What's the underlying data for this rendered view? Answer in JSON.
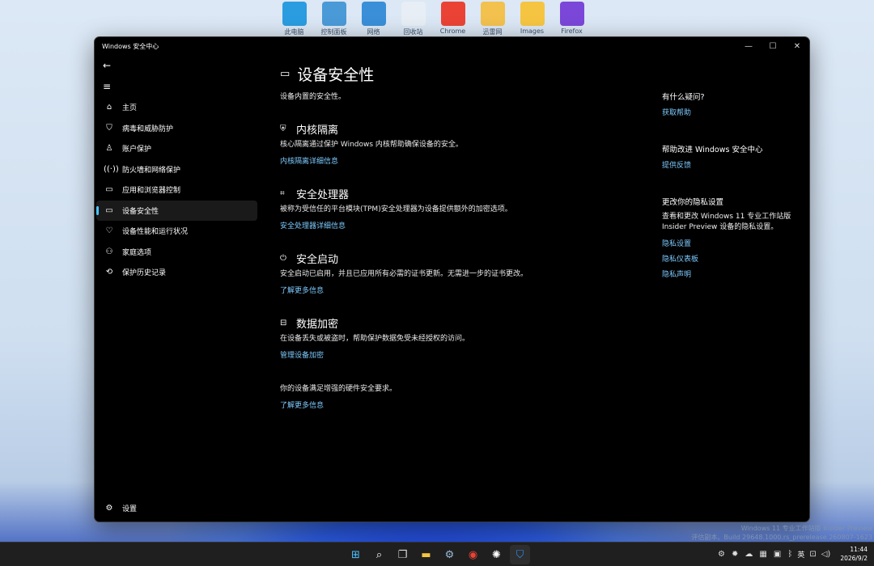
{
  "desktop": {
    "icons": [
      {
        "label": "此电脑",
        "icon": "computer-icon",
        "color": "#2a9de0"
      },
      {
        "label": "控制面板",
        "icon": "control-panel-icon",
        "color": "#4a9ad8"
      },
      {
        "label": "网络",
        "icon": "network-icon",
        "color": "#3a8fd8"
      },
      {
        "label": "回收站",
        "icon": "recycle-bin-icon",
        "color": "#e8eef5"
      },
      {
        "label": "Chrome",
        "icon": "chrome-icon",
        "color": "#ea4335"
      },
      {
        "label": "迅雷网",
        "icon": "contacts-icon",
        "color": "#f2c14e"
      },
      {
        "label": "Images",
        "icon": "folder-icon",
        "color": "#f5c542"
      },
      {
        "label": "Firefox",
        "icon": "firefox-icon",
        "color": "#7b47d8"
      }
    ]
  },
  "window": {
    "title": "Windows 安全中心",
    "controls": {
      "minimize": "—",
      "maximize": "☐",
      "close": "✕"
    }
  },
  "sidebar": {
    "back_icon": "←",
    "menu_icon": "≡",
    "items": [
      {
        "label": "主页",
        "icon": "⌂"
      },
      {
        "label": "病毒和威胁防护",
        "icon": "⛉"
      },
      {
        "label": "账户保护",
        "icon": "♙"
      },
      {
        "label": "防火墙和网络保护",
        "icon": "((·))"
      },
      {
        "label": "应用和浏览器控制",
        "icon": "▭"
      },
      {
        "label": "设备安全性",
        "icon": "▭"
      },
      {
        "label": "设备性能和运行状况",
        "icon": "♡"
      },
      {
        "label": "家庭选项",
        "icon": "⚇"
      },
      {
        "label": "保护历史记录",
        "icon": "⟲"
      }
    ],
    "settings": {
      "label": "设置",
      "icon": "⚙"
    }
  },
  "main": {
    "title": "设备安全性",
    "subtitle": "设备内置的安全性。",
    "sections": [
      {
        "title": "内核隔离",
        "icon": "⛨",
        "desc": "核心隔离通过保护 Windows 内核帮助确保设备的安全。",
        "link": "内核隔离详细信息"
      },
      {
        "title": "安全处理器",
        "icon": "⌗",
        "desc": "被称为受信任的平台模块(TPM)安全处理器为设备提供额外的加密选项。",
        "link": "安全处理器详细信息"
      },
      {
        "title": "安全启动",
        "icon": "⏻",
        "desc": "安全启动已启用，并且已应用所有必需的证书更新。无需进一步的证书更改。",
        "link": "了解更多信息"
      },
      {
        "title": "数据加密",
        "icon": "⊟",
        "desc": "在设备丢失或被盗时，帮助保护数据免受未经授权的访问。",
        "link": "管理设备加密"
      }
    ],
    "footer_text": "你的设备满足增强的硬件安全要求。",
    "footer_link": "了解更多信息"
  },
  "aside": {
    "help_heading": "有什么疑问?",
    "help_link": "获取帮助",
    "improve_heading": "帮助改进 Windows 安全中心",
    "improve_link": "提供反馈",
    "privacy_heading": "更改你的隐私设置",
    "privacy_text": "查看和更改 Windows 11 专业工作站版 Insider Preview 设备的隐私设置。",
    "privacy_links": [
      "隐私设置",
      "隐私仪表板",
      "隐私声明"
    ]
  },
  "watermark": {
    "line1": "Windows 11 专业工作站版 Insider Preview",
    "line2": "评估副本。Build 29648.1000.rs_prerelease.260807-1623"
  },
  "taskbar": {
    "apps": [
      {
        "name": "start-icon",
        "glyph": "⊞",
        "color": "#4cc2ff"
      },
      {
        "name": "search-icon",
        "glyph": "⌕",
        "color": "#ffffff"
      },
      {
        "name": "task-view-icon",
        "glyph": "❐",
        "color": "#dddddd"
      },
      {
        "name": "file-explorer-icon",
        "glyph": "▬",
        "color": "#f5c542"
      },
      {
        "name": "settings-icon",
        "glyph": "⚙",
        "color": "#9bb8d8"
      },
      {
        "name": "chrome-icon",
        "glyph": "◉",
        "color": "#ea4335"
      },
      {
        "name": "chatgpt-icon",
        "glyph": "✺",
        "color": "#ffffff"
      },
      {
        "name": "windows-security-icon",
        "glyph": "⛉",
        "color": "#2f8ff0"
      }
    ],
    "tray": {
      "icons": [
        "⚙",
        "✹",
        "☁",
        "▦",
        "▣",
        "ᛒ"
      ],
      "ime": "英",
      "network": "⊡",
      "volume": "◁)",
      "time": "11:44",
      "date": "2026/9/2"
    }
  }
}
